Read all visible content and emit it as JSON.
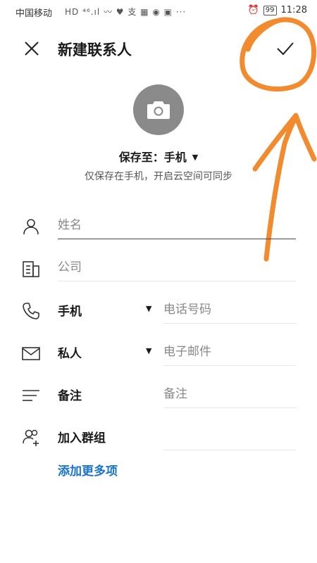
{
  "status_bar": {
    "carrier": "中国移动",
    "icons": "HD ⁴⁶.ıl 〰 ♥ 支 ▦ ◉ ▣ ···",
    "alarm": "⏰",
    "battery": "99",
    "time": "11:28"
  },
  "header": {
    "title": "新建联系人",
    "close_icon": "close-icon",
    "confirm_icon": "checkmark-icon"
  },
  "avatar": {
    "icon": "camera-icon"
  },
  "save_to": {
    "label": "保存至：手机",
    "hint": "仅保存在手机，开启云空间可同步"
  },
  "fields": {
    "name": {
      "placeholder": "姓名",
      "icon": "person-icon"
    },
    "company": {
      "placeholder": "公司",
      "icon": "company-icon"
    },
    "phone": {
      "label": "手机",
      "placeholder": "电话号码",
      "icon": "phone-icon"
    },
    "email": {
      "label": "私人",
      "placeholder": "电子邮件",
      "icon": "mail-icon"
    },
    "note": {
      "label": "备注",
      "placeholder": "备注",
      "icon": "note-icon"
    },
    "group": {
      "label": "加入群组",
      "icon": "add-group-icon"
    }
  },
  "add_more": "添加更多项",
  "colors": {
    "accent": "#1a73c9",
    "annotation": "#f28a2e",
    "avatar_bg": "#8a8a8a"
  }
}
